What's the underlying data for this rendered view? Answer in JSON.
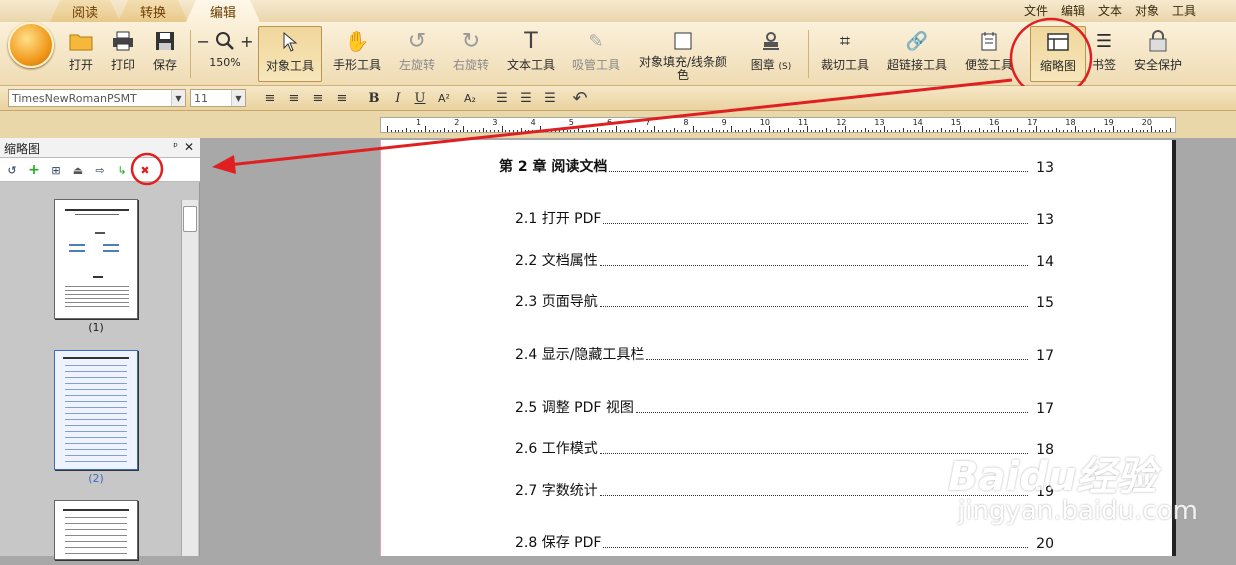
{
  "tabs": [
    "阅读",
    "转换",
    "编辑"
  ],
  "menu": [
    "文件",
    "编辑",
    "文本",
    "对象",
    "工具"
  ],
  "toolbar": {
    "open": "打开",
    "print": "打印",
    "save": "保存",
    "zoom": "150%",
    "object_tool": "对象工具",
    "hand_tool": "手形工具",
    "rotate_left": "左旋转",
    "rotate_right": "右旋转",
    "text_tool": "文本工具",
    "eyedropper": "吸管工具",
    "fill_color": "对象填充/线条颜色",
    "stamp": "图章",
    "stamp_key": "(S)",
    "crop": "裁切工具",
    "hyperlink": "超链接工具",
    "note": "便签工具",
    "thumbnail": "缩略图",
    "bookmark": "书签",
    "security": "安全保护"
  },
  "format": {
    "font": "TimesNewRomanPSMT",
    "size": "11",
    "bold": "B",
    "italic": "I",
    "underline": "U",
    "sup": "A²",
    "sub": "A₂"
  },
  "ruler_numbers": [
    "1",
    "2",
    "3",
    "4",
    "5",
    "6",
    "7",
    "8",
    "9",
    "10",
    "11",
    "12",
    "13",
    "14",
    "15",
    "16",
    "17",
    "18",
    "19",
    "20"
  ],
  "panel": {
    "title": "缩略图",
    "pin": "ᵖ",
    "close": "✕",
    "thumb_labels": [
      "(1)",
      "(2)"
    ]
  },
  "toc": [
    {
      "label": "第 2 章  阅读文档",
      "page": "13",
      "chapter": true
    },
    {
      "label": "2.1 打开 PDF",
      "page": "13"
    },
    {
      "label": "2.2 文档属性",
      "page": "14"
    },
    {
      "label": "2.3 页面导航",
      "page": "15"
    },
    {
      "label": "2.4 显示/隐藏工具栏",
      "page": "17"
    },
    {
      "label": "2.5 调整 PDF 视图",
      "page": "17"
    },
    {
      "label": "2.6 工作模式",
      "page": "18"
    },
    {
      "label": "2.7 字数统计",
      "page": "19"
    },
    {
      "label": "2.8 保存 PDF",
      "page": "20"
    }
  ],
  "watermark": {
    "brand": "Baidu经验",
    "url": "jingyan.baidu.com"
  },
  "colors": {
    "accent": "#e02020",
    "ribbon": "#fbf0da",
    "page_border": "#e8a3b9"
  }
}
